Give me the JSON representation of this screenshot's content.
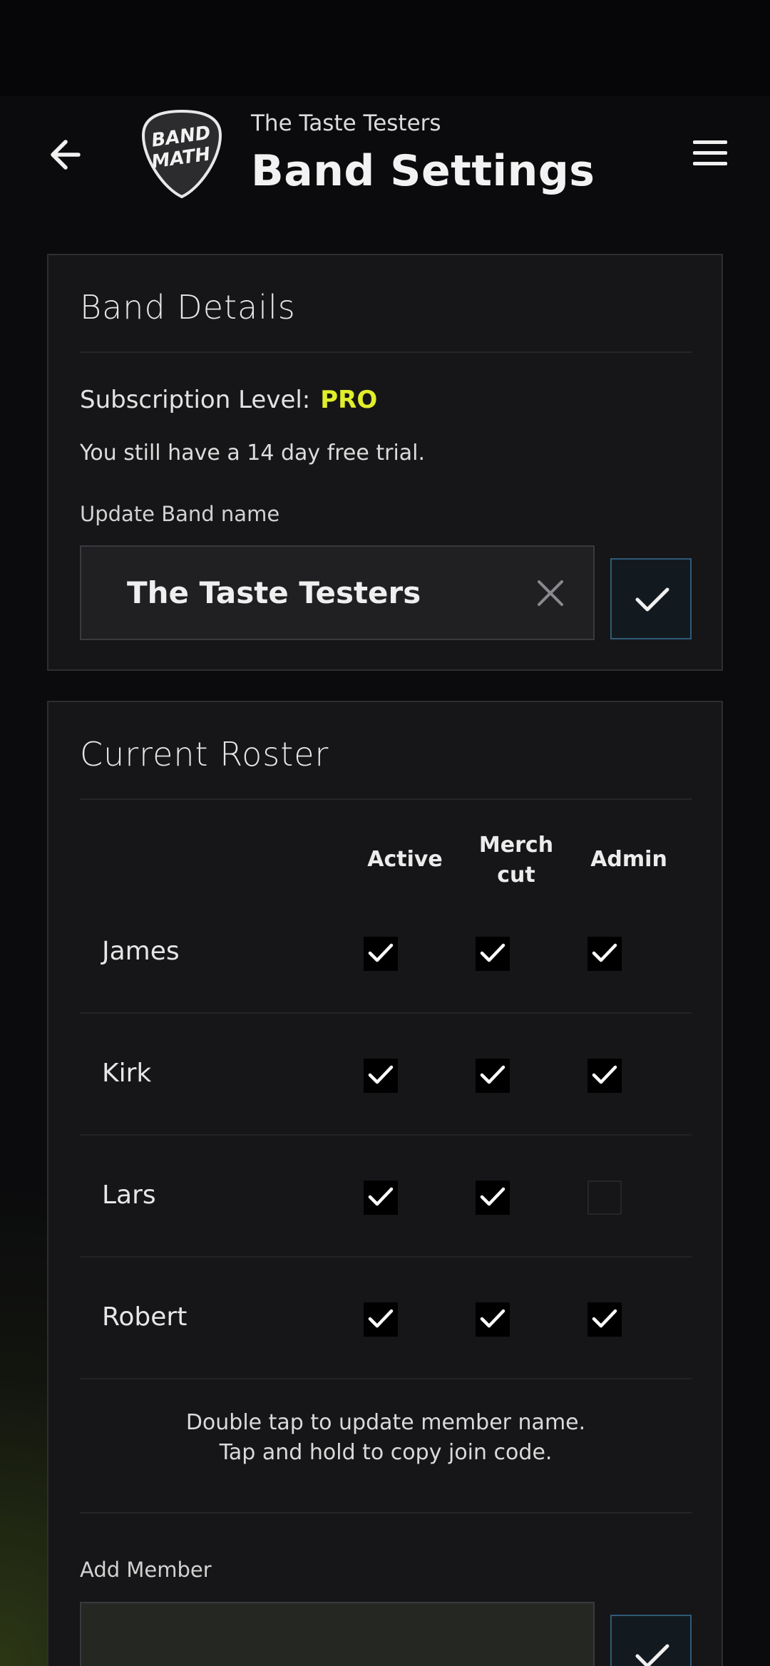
{
  "header": {
    "band_name": "The Taste Testers",
    "title": "Band Settings",
    "logo_text_line1": "BAND",
    "logo_text_line2": "MATH",
    "back_icon": "arrow-left-icon",
    "menu_icon": "hamburger-menu-icon"
  },
  "details": {
    "title": "Band Details",
    "subscription_label": "Subscription Level:",
    "subscription_value": "PRO",
    "trial_text": "You still have a 14 day free trial.",
    "update_label": "Update Band name",
    "band_name_value": "The Taste Testers"
  },
  "roster": {
    "title": "Current Roster",
    "columns": [
      "Active",
      "Merch cut",
      "Admin"
    ],
    "column_lines": {
      "active": "Active",
      "merch_1": "Merch",
      "merch_2": "cut",
      "admin": "Admin"
    },
    "members": [
      {
        "name": "James",
        "active": true,
        "merch_cut": true,
        "admin": true
      },
      {
        "name": "Kirk",
        "active": true,
        "merch_cut": true,
        "admin": true
      },
      {
        "name": "Lars",
        "active": true,
        "merch_cut": true,
        "admin": false
      },
      {
        "name": "Robert",
        "active": true,
        "merch_cut": true,
        "admin": true
      }
    ],
    "hint_line1": "Double tap to update member name.",
    "hint_line2": "Tap and hold to copy join code.",
    "add_label": "Add Member",
    "add_value": ""
  },
  "colors": {
    "accent_pro": "#e1ee2a",
    "confirm_border": "#2f5a78",
    "background": "#0b0b0d",
    "card": "#161618"
  }
}
